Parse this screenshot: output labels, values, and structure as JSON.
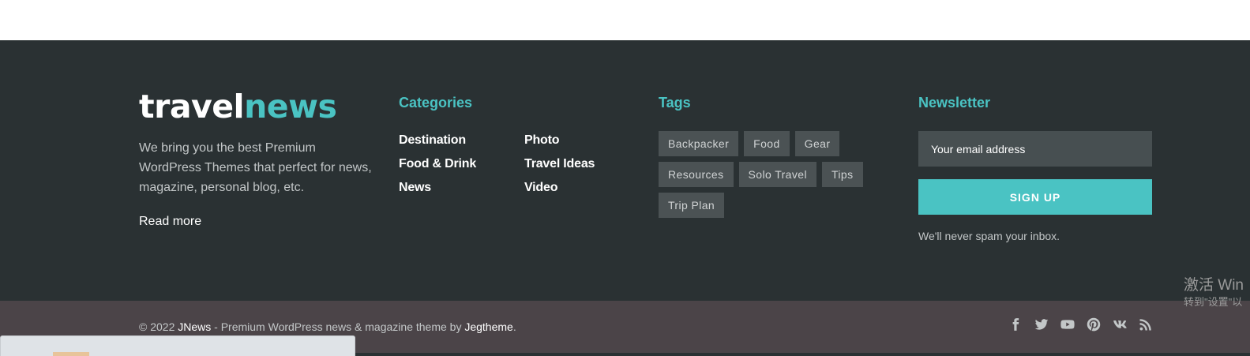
{
  "brand": {
    "logo_part1": "travel",
    "logo_part2": "news",
    "description": "We bring you the best Premium WordPress Themes that perfect for news, magazine, personal blog, etc.",
    "read_more": "Read more"
  },
  "categories": {
    "title": "Categories",
    "items": [
      "Destination",
      "Photo",
      "Food & Drink",
      "Travel Ideas",
      "News",
      "Video"
    ]
  },
  "tags": {
    "title": "Tags",
    "items": [
      "Backpacker",
      "Food",
      "Gear",
      "Resources",
      "Solo Travel",
      "Tips",
      "Trip Plan"
    ]
  },
  "newsletter": {
    "title": "Newsletter",
    "email_placeholder": "Your email address",
    "button_label": "SIGN UP",
    "note": "We'll never spam your inbox."
  },
  "bottom_bar": {
    "copyright_prefix": "© 2022 ",
    "brand_link": "JNews",
    "copyright_middle": " - Premium WordPress news & magazine theme by ",
    "author_link": "Jegtheme",
    "copyright_suffix": ".",
    "social_icons": [
      "facebook-icon",
      "twitter-icon",
      "youtube-icon",
      "pinterest-icon",
      "vk-icon",
      "rss-icon"
    ]
  },
  "watermark": {
    "line1": "激活 Win",
    "line2": "转到\"设置\"以"
  },
  "colors": {
    "accent": "#4ac3c3",
    "footer_bg": "#2a3133",
    "bottom_bar_bg": "#4b4448",
    "tag_bg": "#4b5254"
  }
}
